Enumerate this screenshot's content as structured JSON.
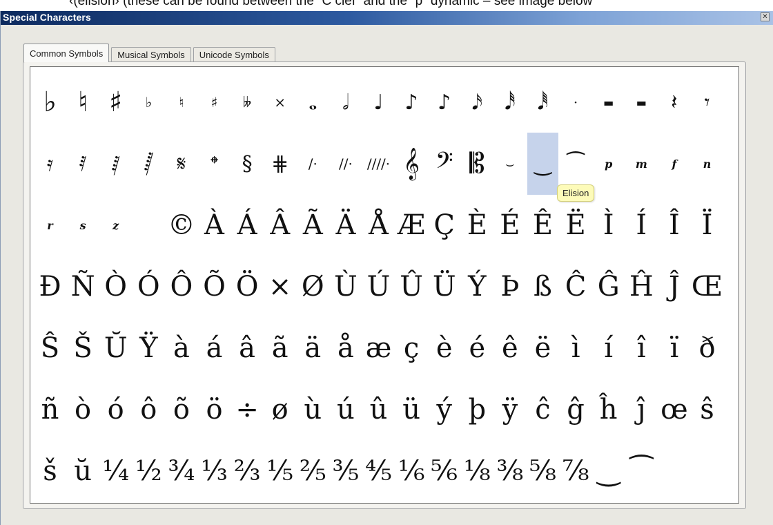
{
  "caption": {
    "text": "‹(elision› (these can be found between the “C clef” and the “p” dynamic – see image below"
  },
  "window": {
    "title": "Special Characters",
    "close_glyph": "✕"
  },
  "tabs": [
    {
      "label": "Common Symbols",
      "active": true
    },
    {
      "label": "Musical Symbols",
      "active": false
    },
    {
      "label": "Unicode Symbols",
      "active": false
    }
  ],
  "tooltip": {
    "text": "Elision"
  },
  "grid": {
    "rows": [
      [
        {
          "g": "♭",
          "s": "l",
          "n": "flat-icon"
        },
        {
          "g": "♮",
          "s": "l",
          "n": "natural-icon"
        },
        {
          "g": "♯",
          "s": "l",
          "n": "sharp-icon"
        },
        {
          "g": "♭",
          "s": "s",
          "n": "small-flat-icon"
        },
        {
          "g": "♮",
          "s": "s",
          "n": "small-natural-icon"
        },
        {
          "g": "♯",
          "s": "s",
          "n": "small-sharp-icon"
        },
        {
          "g": "𝄫",
          "s": "s",
          "n": "double-flat-icon"
        },
        {
          "g": "×",
          "s": "s",
          "n": "double-sharp-icon"
        },
        {
          "g": "𝅝",
          "s": "m",
          "n": "whole-note-icon"
        },
        {
          "g": "𝅗𝅥",
          "s": "m",
          "n": "half-note-icon"
        },
        {
          "g": "♩",
          "s": "m",
          "n": "quarter-note-icon"
        },
        {
          "g": "♪",
          "s": "m",
          "n": "eighth-note-icon"
        },
        {
          "g": "♪",
          "s": "m",
          "n": "sixteenth-note-icon"
        },
        {
          "g": "𝅘𝅥𝅯",
          "s": "m",
          "n": "thirty-second-note-icon"
        },
        {
          "g": "𝅘𝅥𝅰",
          "s": "m",
          "n": "sixty-fourth-note-icon"
        },
        {
          "g": "𝅘𝅥𝅱",
          "s": "m",
          "n": "hundred-twenty-eighth-note-icon"
        },
        {
          "g": "·",
          "s": "s",
          "n": "augmentation-dot-icon"
        },
        {
          "g": "▬",
          "s": "xs",
          "n": "whole-rest-icon"
        },
        {
          "g": "▬",
          "s": "xs",
          "n": "half-rest-icon"
        },
        {
          "g": "𝄽",
          "s": "m",
          "n": "quarter-rest-icon"
        },
        {
          "g": "𝄾",
          "s": "m",
          "n": "eighth-rest-icon"
        }
      ],
      [
        {
          "g": "𝄿",
          "s": "m",
          "n": "sixteenth-rest-icon"
        },
        {
          "g": "𝅀",
          "s": "m",
          "n": "thirty-second-rest-icon"
        },
        {
          "g": "𝅁",
          "s": "m",
          "n": "sixty-fourth-rest-icon"
        },
        {
          "g": "𝅂",
          "s": "m",
          "n": "hundred-twenty-eighth-rest-icon"
        },
        {
          "g": "𝄋",
          "s": "m",
          "n": "segno-icon"
        },
        {
          "g": "𝄌",
          "s": "m",
          "n": "coda-icon"
        },
        {
          "g": "§",
          "s": "m",
          "n": "section-sign-icon"
        },
        {
          "g": "⋕",
          "s": "m",
          "n": "square-coda-icon"
        },
        {
          "g": "∕·",
          "s": "s",
          "n": "single-repeat-icon"
        },
        {
          "g": "//·",
          "s": "s",
          "n": "double-repeat-icon"
        },
        {
          "g": "////·",
          "s": "s",
          "n": "quadruple-repeat-icon"
        },
        {
          "g": "𝄞",
          "s": "l",
          "n": "treble-clef-icon"
        },
        {
          "g": "𝄢",
          "s": "l",
          "n": "bass-clef-icon"
        },
        {
          "g": "𝄡",
          "s": "l",
          "n": "c-clef-icon"
        },
        {
          "g": "⌣",
          "s": "s",
          "n": "short-elision-icon"
        },
        {
          "g": "‿",
          "s": "m",
          "n": "elision-icon",
          "sel": true
        },
        {
          "g": "⁀",
          "s": "m",
          "n": "long-elision-icon"
        },
        {
          "g": "p",
          "s": "dyn",
          "n": "piano-dynamic-icon"
        },
        {
          "g": "m",
          "s": "dyn",
          "n": "mezzo-dynamic-icon"
        },
        {
          "g": "f",
          "s": "dyn",
          "n": "forte-dynamic-icon"
        },
        {
          "g": "n",
          "s": "dyn",
          "n": "niente-dynamic-icon"
        }
      ],
      [
        {
          "g": "r",
          "s": "dyn",
          "n": "rinforzando-dynamic-icon"
        },
        {
          "g": "s",
          "s": "dyn",
          "n": "sforzando-dynamic-icon"
        },
        {
          "g": "z",
          "s": "dyn",
          "n": "z-dynamic-icon"
        },
        {
          "g": "",
          "s": "l",
          "n": "empty-symbol-cell"
        },
        {
          "g": "©",
          "s": "l",
          "n": "copyright-icon"
        },
        {
          "g": "À",
          "s": "l",
          "n": "a-grave-upper"
        },
        {
          "g": "Á",
          "s": "l",
          "n": "a-acute-upper"
        },
        {
          "g": "Â",
          "s": "l",
          "n": "a-circumflex-upper"
        },
        {
          "g": "Ã",
          "s": "l",
          "n": "a-tilde-upper"
        },
        {
          "g": "Ä",
          "s": "l",
          "n": "a-umlaut-upper"
        },
        {
          "g": "Å",
          "s": "l",
          "n": "a-ring-upper"
        },
        {
          "g": "Æ",
          "s": "l",
          "n": "ae-ligature-upper"
        },
        {
          "g": "Ç",
          "s": "l",
          "n": "c-cedilla-upper"
        },
        {
          "g": "È",
          "s": "l",
          "n": "e-grave-upper"
        },
        {
          "g": "É",
          "s": "l",
          "n": "e-acute-upper"
        },
        {
          "g": "Ê",
          "s": "l",
          "n": "e-circumflex-upper"
        },
        {
          "g": "Ë",
          "s": "l",
          "n": "e-umlaut-upper"
        },
        {
          "g": "Ì",
          "s": "l",
          "n": "i-grave-upper"
        },
        {
          "g": "Í",
          "s": "l",
          "n": "i-acute-upper"
        },
        {
          "g": "Î",
          "s": "l",
          "n": "i-circumflex-upper"
        },
        {
          "g": "Ï",
          "s": "l",
          "n": "i-umlaut-upper"
        }
      ],
      [
        {
          "g": "Ð",
          "s": "l",
          "n": "eth-upper"
        },
        {
          "g": "Ñ",
          "s": "l",
          "n": "n-tilde-upper"
        },
        {
          "g": "Ò",
          "s": "l",
          "n": "o-grave-upper"
        },
        {
          "g": "Ó",
          "s": "l",
          "n": "o-acute-upper"
        },
        {
          "g": "Ô",
          "s": "l",
          "n": "o-circumflex-upper"
        },
        {
          "g": "Õ",
          "s": "l",
          "n": "o-tilde-upper"
        },
        {
          "g": "Ö",
          "s": "l",
          "n": "o-umlaut-upper"
        },
        {
          "g": "×",
          "s": "l",
          "n": "multiplication-sign"
        },
        {
          "g": "Ø",
          "s": "l",
          "n": "o-stroke-upper"
        },
        {
          "g": "Ù",
          "s": "l",
          "n": "u-grave-upper"
        },
        {
          "g": "Ú",
          "s": "l",
          "n": "u-acute-upper"
        },
        {
          "g": "Û",
          "s": "l",
          "n": "u-circumflex-upper"
        },
        {
          "g": "Ü",
          "s": "l",
          "n": "u-umlaut-upper"
        },
        {
          "g": "Ý",
          "s": "l",
          "n": "y-acute-upper"
        },
        {
          "g": "Þ",
          "s": "l",
          "n": "thorn-upper"
        },
        {
          "g": "ß",
          "s": "l",
          "n": "sharp-s"
        },
        {
          "g": "Ĉ",
          "s": "l",
          "n": "c-circumflex-upper"
        },
        {
          "g": "Ĝ",
          "s": "l",
          "n": "g-circumflex-upper"
        },
        {
          "g": "Ĥ",
          "s": "l",
          "n": "h-circumflex-upper"
        },
        {
          "g": "Ĵ",
          "s": "l",
          "n": "j-circumflex-upper"
        },
        {
          "g": "Œ",
          "s": "l",
          "n": "oe-ligature-upper"
        }
      ],
      [
        {
          "g": "Ŝ",
          "s": "l",
          "n": "s-circumflex-upper"
        },
        {
          "g": "Š",
          "s": "l",
          "n": "s-caron-upper"
        },
        {
          "g": "Ŭ",
          "s": "l",
          "n": "u-breve-upper"
        },
        {
          "g": "Ÿ",
          "s": "l",
          "n": "y-umlaut-upper"
        },
        {
          "g": "à",
          "s": "l",
          "n": "a-grave-lower"
        },
        {
          "g": "á",
          "s": "l",
          "n": "a-acute-lower"
        },
        {
          "g": "â",
          "s": "l",
          "n": "a-circumflex-lower"
        },
        {
          "g": "ã",
          "s": "l",
          "n": "a-tilde-lower"
        },
        {
          "g": "ä",
          "s": "l",
          "n": "a-umlaut-lower"
        },
        {
          "g": "å",
          "s": "l",
          "n": "a-ring-lower"
        },
        {
          "g": "æ",
          "s": "l",
          "n": "ae-ligature-lower"
        },
        {
          "g": "ç",
          "s": "l",
          "n": "c-cedilla-lower"
        },
        {
          "g": "è",
          "s": "l",
          "n": "e-grave-lower"
        },
        {
          "g": "é",
          "s": "l",
          "n": "e-acute-lower"
        },
        {
          "g": "ê",
          "s": "l",
          "n": "e-circumflex-lower"
        },
        {
          "g": "ë",
          "s": "l",
          "n": "e-umlaut-lower"
        },
        {
          "g": "ì",
          "s": "l",
          "n": "i-grave-lower"
        },
        {
          "g": "í",
          "s": "l",
          "n": "i-acute-lower"
        },
        {
          "g": "î",
          "s": "l",
          "n": "i-circumflex-lower"
        },
        {
          "g": "ï",
          "s": "l",
          "n": "i-umlaut-lower"
        },
        {
          "g": "ð",
          "s": "l",
          "n": "eth-lower"
        }
      ],
      [
        {
          "g": "ñ",
          "s": "l",
          "n": "n-tilde-lower"
        },
        {
          "g": "ò",
          "s": "l",
          "n": "o-grave-lower"
        },
        {
          "g": "ó",
          "s": "l",
          "n": "o-acute-lower"
        },
        {
          "g": "ô",
          "s": "l",
          "n": "o-circumflex-lower"
        },
        {
          "g": "õ",
          "s": "l",
          "n": "o-tilde-lower"
        },
        {
          "g": "ö",
          "s": "l",
          "n": "o-umlaut-lower"
        },
        {
          "g": "÷",
          "s": "l",
          "n": "division-sign"
        },
        {
          "g": "ø",
          "s": "l",
          "n": "o-stroke-lower"
        },
        {
          "g": "ù",
          "s": "l",
          "n": "u-grave-lower"
        },
        {
          "g": "ú",
          "s": "l",
          "n": "u-acute-lower"
        },
        {
          "g": "û",
          "s": "l",
          "n": "u-circumflex-lower"
        },
        {
          "g": "ü",
          "s": "l",
          "n": "u-umlaut-lower"
        },
        {
          "g": "ý",
          "s": "l",
          "n": "y-acute-lower"
        },
        {
          "g": "þ",
          "s": "l",
          "n": "thorn-lower"
        },
        {
          "g": "ÿ",
          "s": "l",
          "n": "y-umlaut-lower"
        },
        {
          "g": "ĉ",
          "s": "l",
          "n": "c-circumflex-lower"
        },
        {
          "g": "ĝ",
          "s": "l",
          "n": "g-circumflex-lower"
        },
        {
          "g": "ĥ",
          "s": "l",
          "n": "h-circumflex-lower"
        },
        {
          "g": "ĵ",
          "s": "l",
          "n": "j-circumflex-lower"
        },
        {
          "g": "œ",
          "s": "l",
          "n": "oe-ligature-lower"
        },
        {
          "g": "ŝ",
          "s": "l",
          "n": "s-circumflex-lower"
        }
      ],
      [
        {
          "g": "š",
          "s": "l",
          "n": "s-caron-lower"
        },
        {
          "g": "ŭ",
          "s": "l",
          "n": "u-breve-lower"
        },
        {
          "g": "¼",
          "s": "l",
          "n": "one-quarter-fraction"
        },
        {
          "g": "½",
          "s": "l",
          "n": "one-half-fraction"
        },
        {
          "g": "¾",
          "s": "l",
          "n": "three-quarters-fraction"
        },
        {
          "g": "⅓",
          "s": "l",
          "n": "one-third-fraction"
        },
        {
          "g": "⅔",
          "s": "l",
          "n": "two-thirds-fraction"
        },
        {
          "g": "⅕",
          "s": "l",
          "n": "one-fifth-fraction"
        },
        {
          "g": "⅖",
          "s": "l",
          "n": "two-fifths-fraction"
        },
        {
          "g": "⅗",
          "s": "l",
          "n": "three-fifths-fraction"
        },
        {
          "g": "⅘",
          "s": "l",
          "n": "four-fifths-fraction"
        },
        {
          "g": "⅙",
          "s": "l",
          "n": "one-sixth-fraction"
        },
        {
          "g": "⅚",
          "s": "l",
          "n": "five-sixths-fraction"
        },
        {
          "g": "⅛",
          "s": "l",
          "n": "one-eighth-fraction"
        },
        {
          "g": "⅜",
          "s": "l",
          "n": "three-eighths-fraction"
        },
        {
          "g": "⅝",
          "s": "l",
          "n": "five-eighths-fraction"
        },
        {
          "g": "⅞",
          "s": "l",
          "n": "seven-eighths-fraction"
        },
        {
          "g": "‿",
          "s": "l",
          "n": "tie-below-icon"
        },
        {
          "g": "⁀",
          "s": "l",
          "n": "tie-above-icon"
        }
      ]
    ]
  }
}
